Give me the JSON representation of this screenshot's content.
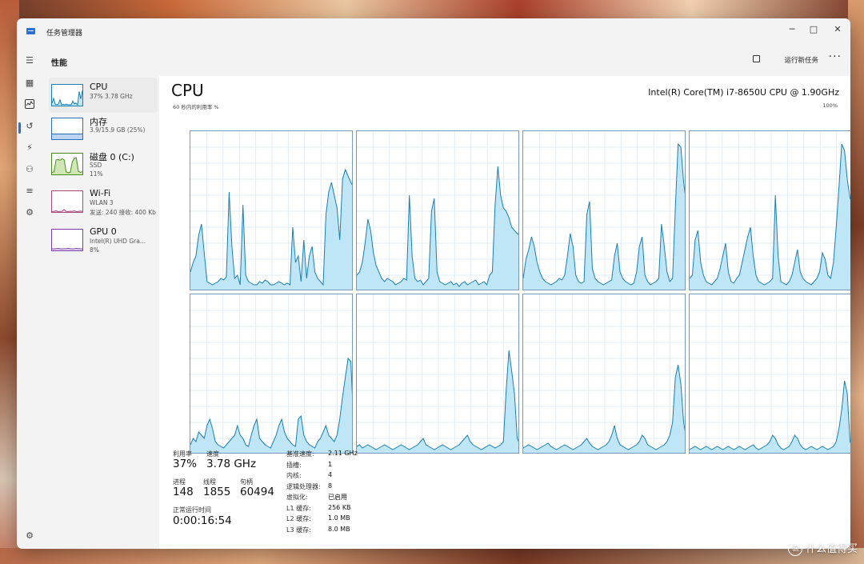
{
  "window": {
    "title": "任务管理器",
    "controls": [
      "─",
      "□",
      "✕"
    ]
  },
  "topbar": {
    "page": "性能",
    "run_new_task": "运行新任务",
    "more": "···"
  },
  "rail_icons": [
    "menu-icon",
    "processes-icon",
    "performance-icon",
    "history-icon",
    "startup-icon",
    "users-icon",
    "details-icon",
    "services-icon",
    "settings-icon"
  ],
  "sidebar": {
    "items": [
      {
        "name": "CPU",
        "sub1": "37% 3.78 GHz",
        "sub2": "",
        "color": "#1a7fb0"
      },
      {
        "name": "内存",
        "sub1": "3.9/15.9 GB (25%)",
        "sub2": "",
        "color": "#2f6fb5"
      },
      {
        "name": "磁盘 0 (C:)",
        "sub1": "SSD",
        "sub2": "11%",
        "color": "#4a8a1c"
      },
      {
        "name": "Wi-Fi",
        "sub1": "WLAN 3",
        "sub2": "发送: 240 接收: 400 Kb",
        "color": "#a8497a"
      },
      {
        "name": "GPU 0",
        "sub1": "Intel(R) UHD Gra...",
        "sub2": "8%",
        "color": "#7a3fa6"
      }
    ]
  },
  "main": {
    "title": "CPU",
    "model": "Intel(R) Core(TM) i7-8650U CPU @ 1.90GHz",
    "axis_left": "60 秒内的利用率 %",
    "axis_right": "100%",
    "accent": "#1a7fb0",
    "fill": "#bfe6f7"
  },
  "chart_data": {
    "type": "area",
    "x_range_seconds": [
      0,
      60
    ],
    "ylim": [
      0,
      100
    ],
    "grid": true,
    "series": [
      {
        "values": [
          12,
          18,
          22,
          35,
          42,
          24,
          6,
          5,
          4,
          5,
          6,
          8,
          7,
          9,
          62,
          28,
          8,
          10,
          4,
          54,
          10,
          6,
          5,
          4,
          4,
          6,
          5,
          7,
          6,
          4,
          4,
          5,
          6,
          5,
          4,
          5,
          4,
          40,
          18,
          22,
          6,
          32,
          8,
          22,
          28,
          12,
          8,
          6,
          4,
          48,
          62,
          68,
          60,
          52,
          32,
          70,
          76,
          72,
          68,
          65
        ]
      },
      {
        "values": [
          10,
          12,
          18,
          30,
          45,
          38,
          24,
          16,
          12,
          8,
          6,
          8,
          7,
          6,
          4,
          5,
          6,
          8,
          7,
          60,
          22,
          8,
          6,
          7,
          4,
          6,
          8,
          50,
          58,
          12,
          6,
          5,
          4,
          5,
          6,
          4,
          5,
          3,
          5,
          6,
          4,
          5,
          6,
          7,
          4,
          5,
          6,
          4,
          10,
          12,
          54,
          78,
          60,
          52,
          50,
          46,
          40,
          38,
          36,
          35
        ]
      },
      {
        "values": [
          8,
          20,
          26,
          34,
          28,
          18,
          12,
          8,
          6,
          5,
          4,
          5,
          6,
          8,
          7,
          10,
          22,
          36,
          28,
          10,
          6,
          5,
          6,
          48,
          56,
          14,
          8,
          6,
          5,
          4,
          5,
          6,
          7,
          22,
          30,
          12,
          8,
          6,
          5,
          4,
          5,
          12,
          28,
          34,
          10,
          6,
          4,
          5,
          6,
          8,
          42,
          28,
          12,
          6,
          8,
          52,
          92,
          90,
          68,
          55
        ]
      },
      {
        "values": [
          8,
          10,
          32,
          38,
          18,
          10,
          6,
          5,
          4,
          6,
          8,
          14,
          22,
          30,
          12,
          6,
          5,
          8,
          10,
          18,
          26,
          34,
          40,
          22,
          10,
          6,
          5,
          4,
          5,
          6,
          8,
          60,
          22,
          6,
          5,
          4,
          6,
          10,
          18,
          26,
          12,
          8,
          6,
          5,
          4,
          6,
          8,
          12,
          24,
          20,
          10,
          8,
          18,
          40,
          65,
          92,
          88,
          70,
          58,
          56
        ]
      },
      {
        "values": [
          6,
          10,
          8,
          14,
          12,
          10,
          18,
          22,
          16,
          8,
          6,
          5,
          4,
          6,
          8,
          10,
          12,
          18,
          12,
          10,
          6,
          5,
          12,
          18,
          22,
          10,
          8,
          6,
          5,
          4,
          8,
          12,
          18,
          22,
          14,
          10,
          8,
          6,
          5,
          22,
          24,
          12,
          8,
          6,
          5,
          4,
          8,
          10,
          14,
          18,
          12,
          10,
          8,
          12,
          22,
          36,
          48,
          60,
          58,
          20
        ]
      },
      {
        "values": [
          5,
          6,
          4,
          5,
          6,
          5,
          4,
          3,
          4,
          5,
          6,
          5,
          4,
          3,
          4,
          5,
          6,
          5,
          4,
          3,
          4,
          5,
          6,
          8,
          10,
          6,
          5,
          4,
          3,
          4,
          5,
          6,
          5,
          4,
          3,
          4,
          5,
          6,
          8,
          10,
          12,
          8,
          6,
          5,
          4,
          3,
          4,
          5,
          6,
          5,
          4,
          5,
          6,
          8,
          40,
          65,
          52,
          38,
          10,
          6
        ]
      },
      {
        "values": [
          4,
          5,
          6,
          5,
          4,
          3,
          4,
          5,
          6,
          7,
          5,
          4,
          3,
          4,
          5,
          6,
          5,
          4,
          3,
          4,
          5,
          6,
          8,
          10,
          7,
          5,
          4,
          3,
          4,
          5,
          6,
          8,
          12,
          18,
          10,
          6,
          5,
          4,
          3,
          4,
          5,
          6,
          8,
          12,
          10,
          6,
          5,
          4,
          3,
          4,
          5,
          6,
          8,
          12,
          20,
          48,
          56,
          44,
          20,
          10
        ]
      },
      {
        "values": [
          3,
          4,
          5,
          4,
          3,
          4,
          5,
          4,
          3,
          4,
          5,
          4,
          3,
          4,
          5,
          4,
          3,
          4,
          5,
          4,
          3,
          4,
          5,
          6,
          4,
          3,
          4,
          5,
          6,
          8,
          12,
          10,
          6,
          4,
          3,
          4,
          5,
          8,
          12,
          10,
          6,
          4,
          3,
          4,
          5,
          4,
          3,
          4,
          5,
          4,
          3,
          4,
          5,
          8,
          16,
          28,
          46,
          38,
          8,
          4
        ]
      }
    ]
  },
  "stats": {
    "utilization_label": "利用率",
    "utilization": "37%",
    "speed_label": "速度",
    "speed": "3.78 GHz",
    "processes_label": "进程",
    "processes": "148",
    "threads_label": "线程",
    "threads": "1855",
    "handles_label": "句柄",
    "handles": "60494",
    "uptime_label": "正常运行时间",
    "uptime": "0:00:16:54"
  },
  "details": [
    {
      "k": "基准速度:",
      "v": "2.11 GHz"
    },
    {
      "k": "插槽:",
      "v": "1"
    },
    {
      "k": "内核:",
      "v": "4"
    },
    {
      "k": "逻辑处理器:",
      "v": "8"
    },
    {
      "k": "虚拟化:",
      "v": "已启用"
    },
    {
      "k": "L1 缓存:",
      "v": "256 KB"
    },
    {
      "k": "L2 缓存:",
      "v": "1.0 MB"
    },
    {
      "k": "L3 缓存:",
      "v": "8.0 MB"
    }
  ],
  "watermark": "什么值得买"
}
